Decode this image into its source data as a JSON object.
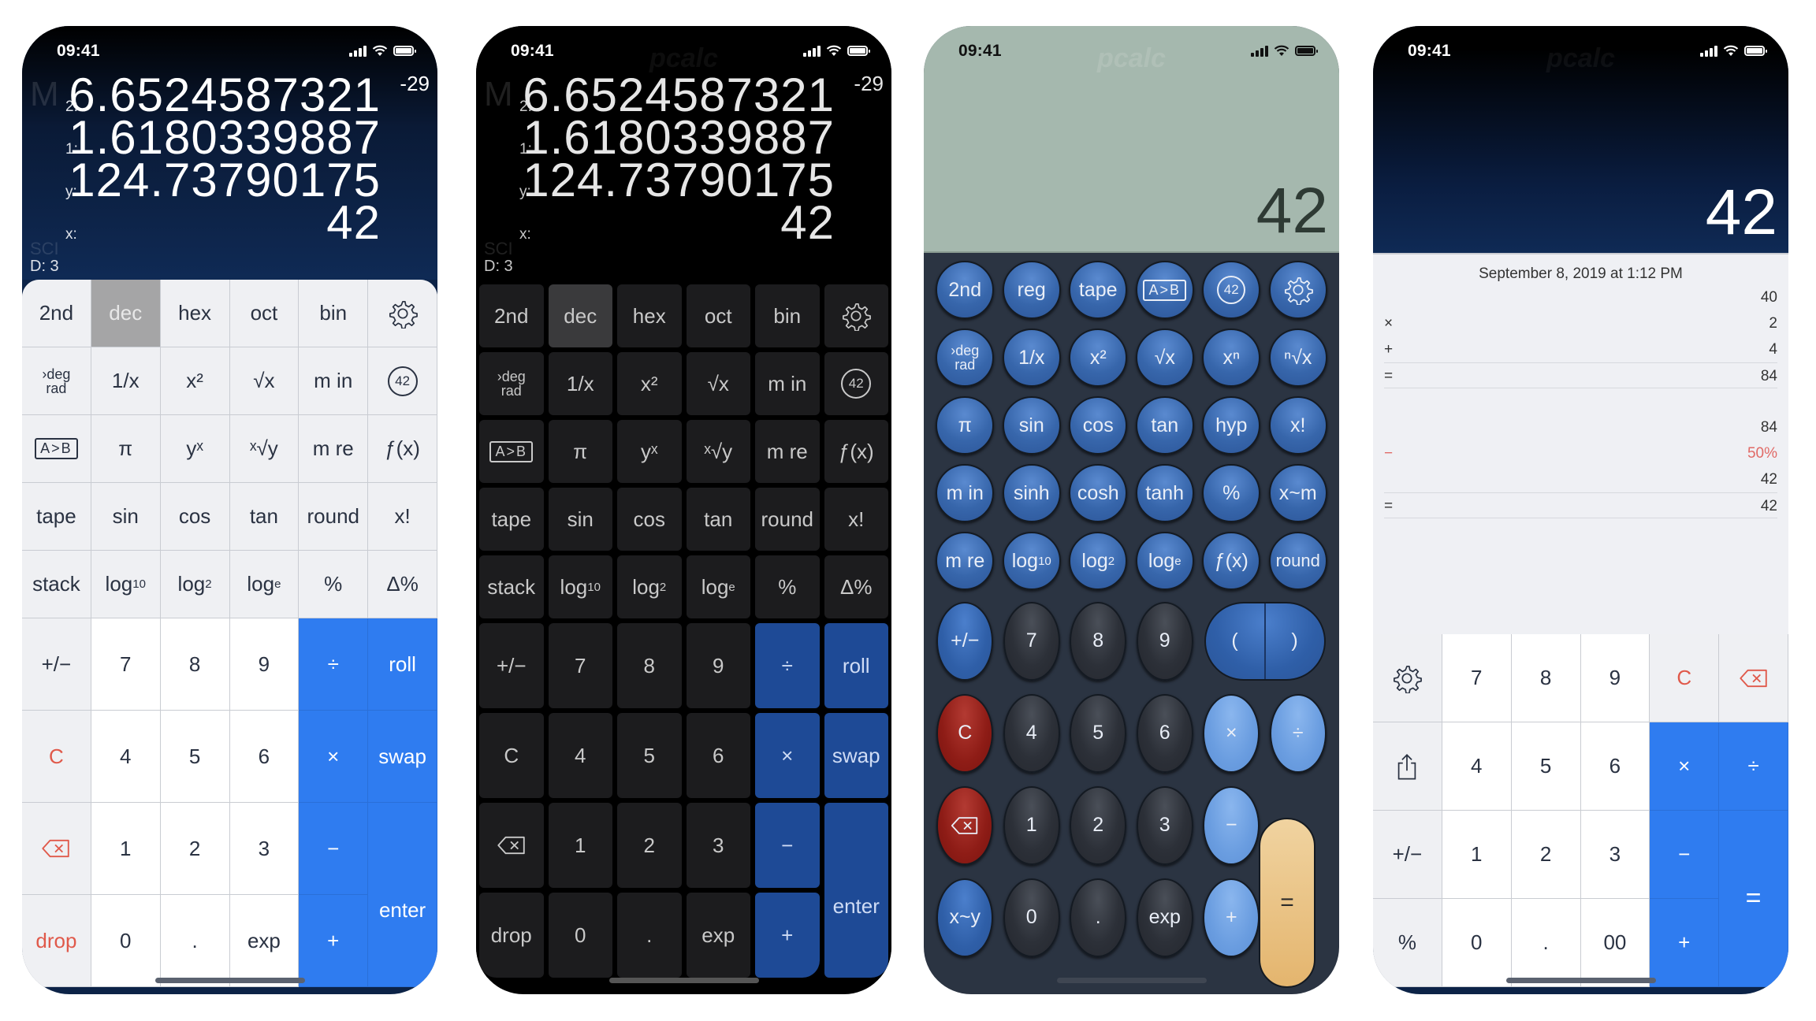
{
  "status_bar": {
    "time": "09:41"
  },
  "watermark": "pcalc",
  "phone1": {
    "theme": "light-rpn",
    "memory_flag": "M",
    "sci_flag": "SCI",
    "digits_flag": "D: 3",
    "stack": [
      {
        "reg": "2:",
        "value": "6.6524587321",
        "exponent": "-29"
      },
      {
        "reg": "1:",
        "value": "1.6180339887",
        "exponent": ""
      },
      {
        "reg": "y:",
        "value": "124.73790175",
        "exponent": ""
      },
      {
        "reg": "x:",
        "value": "42",
        "exponent": ""
      }
    ],
    "sci_keys": [
      [
        "2nd",
        "dec",
        "hex",
        "oct",
        "bin",
        "gear-icon"
      ],
      [
        "deg/rad",
        "1/x",
        "x²",
        "√x",
        "m in",
        "42-icon"
      ],
      [
        "A>B",
        "π",
        "yˣ",
        "ˣ√y",
        "m re",
        "ƒ(x)"
      ],
      [
        "tape",
        "sin",
        "cos",
        "tan",
        "round",
        "x!"
      ],
      [
        "stack",
        "log10",
        "log2",
        "loge",
        "%",
        "Δ%"
      ]
    ],
    "num_keys": {
      "row1": [
        "+/−",
        "7",
        "8",
        "9",
        "÷",
        "roll"
      ],
      "row2": [
        "C",
        "4",
        "5",
        "6",
        "×",
        "swap"
      ],
      "row3": [
        "backspace-icon",
        "1",
        "2",
        "3",
        "−"
      ],
      "row4": [
        "drop",
        "0",
        ".",
        "exp",
        "+"
      ],
      "enter": "enter"
    },
    "active_base": "dec",
    "colors": {
      "accent": "#2f7cf0",
      "clear": "#e0594a",
      "active": "#a5a5a6"
    }
  },
  "phone2": {
    "theme": "dark-rpn",
    "memory_flag": "M",
    "sci_flag": "SCI",
    "digits_flag": "D: 3",
    "stack": [
      {
        "reg": "2:",
        "value": "6.6524587321",
        "exponent": "-29"
      },
      {
        "reg": "1:",
        "value": "1.6180339887",
        "exponent": ""
      },
      {
        "reg": "y:",
        "value": "124.73790175",
        "exponent": ""
      },
      {
        "reg": "x:",
        "value": "42",
        "exponent": ""
      }
    ],
    "active_base": "dec",
    "colors": {
      "accent": "#1e4a96",
      "key": "#1c1c1e"
    }
  },
  "phone3": {
    "theme": "retro-round",
    "display_value": "42",
    "rows": [
      [
        "2nd",
        "reg",
        "tape",
        "A>B",
        "42-icon",
        "gear-icon"
      ],
      [
        "deg/rad",
        "1/x",
        "x²",
        "√x",
        "xⁿ",
        "ⁿ√x"
      ],
      [
        "π",
        "sin",
        "cos",
        "tan",
        "hyp",
        "x!"
      ],
      [
        "m in",
        "sinh",
        "cosh",
        "tanh",
        "%",
        "x~m"
      ],
      [
        "m re",
        "log10",
        "log2",
        "loge",
        "ƒ(x)",
        "round"
      ]
    ],
    "num_rows": {
      "row1": [
        "+/−",
        "7",
        "8",
        "9",
        "(",
        ")"
      ],
      "row2": [
        "C",
        "4",
        "5",
        "6",
        "×",
        "÷"
      ],
      "row3": [
        "backspace-icon",
        "1",
        "2",
        "3",
        "−"
      ],
      "row4": [
        "x~y",
        "0",
        ".",
        "exp",
        "+"
      ],
      "equals": "="
    },
    "colors": {
      "lcd": "#a5b8ae",
      "key_blue": "#3766ab",
      "key_red": "#8e1c16",
      "key_light": "#6a9de0",
      "equals": "#e4b56e"
    }
  },
  "phone4": {
    "theme": "tape-basic",
    "display_value": "42",
    "tape": {
      "date": "September 8, 2019 at 1:12 PM",
      "lines": [
        {
          "op": "",
          "value": "40"
        },
        {
          "op": "×",
          "value": "2"
        },
        {
          "op": "+",
          "value": "4"
        },
        {
          "op": "=",
          "value": "84"
        },
        {
          "op": "",
          "value": "84"
        },
        {
          "op": "−",
          "value": "50%"
        },
        {
          "op": "",
          "value": "42"
        },
        {
          "op": "=",
          "value": "42"
        }
      ]
    },
    "keys": {
      "row1": [
        "gear-icon",
        "7",
        "8",
        "9",
        "C",
        "backspace-icon"
      ],
      "row2": [
        "share-icon",
        "4",
        "5",
        "6",
        "×",
        "÷"
      ],
      "row3": [
        "+/−",
        "1",
        "2",
        "3",
        "−"
      ],
      "row4": [
        "%",
        "0",
        ".",
        "00",
        "+"
      ],
      "equals": "="
    }
  }
}
